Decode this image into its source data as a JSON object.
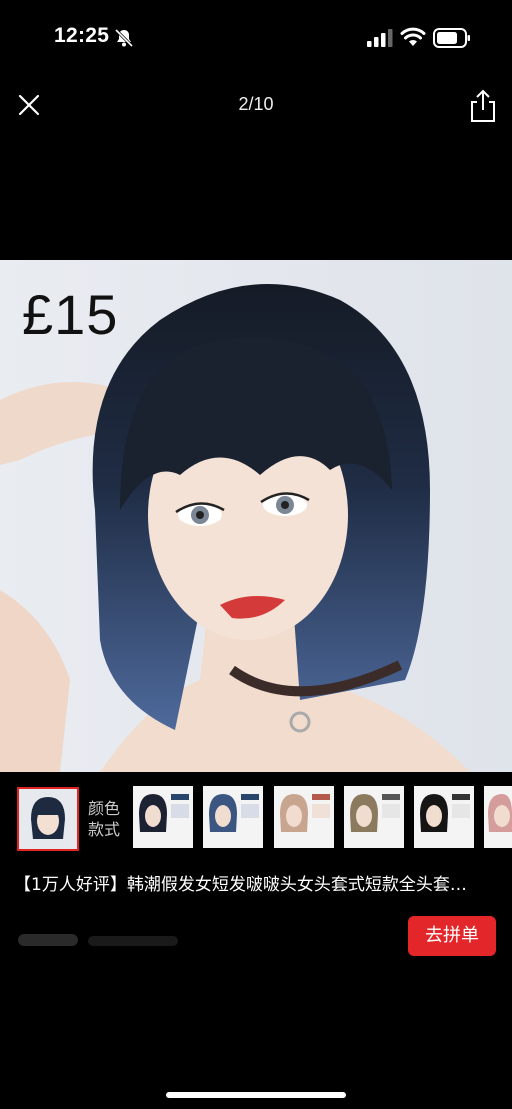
{
  "status_bar": {
    "time": "12:25"
  },
  "top_bar": {
    "page_counter": "2/10"
  },
  "photo": {
    "price": "£15"
  },
  "variants": {
    "label_line1": "颜色",
    "label_line2": "款式"
  },
  "product": {
    "title": "【1万人好评】韩潮假发女短发啵啵头女头套式短款全头套…",
    "join_button": "去拼单"
  },
  "colors": {
    "accent": "#e3262a",
    "background": "#000000"
  }
}
